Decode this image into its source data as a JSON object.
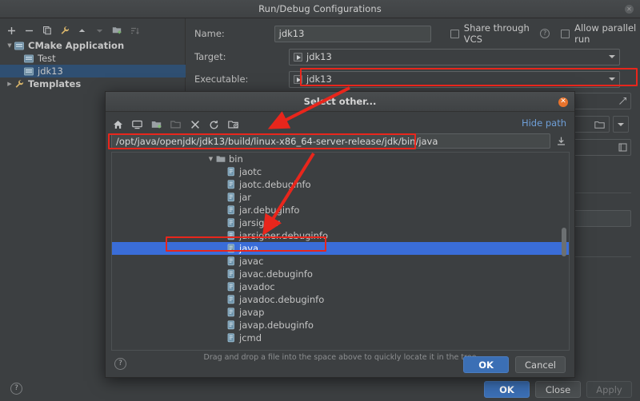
{
  "window": {
    "title": "Run/Debug Configurations",
    "close_icon": "close-icon"
  },
  "config_toolbar": {
    "items": [
      {
        "name": "add-button",
        "glyph": "+",
        "enabled": true
      },
      {
        "name": "remove-button",
        "glyph": "−",
        "enabled": true
      },
      {
        "name": "copy-button",
        "glyph": "copy-icon",
        "enabled": true
      },
      {
        "name": "edit-templates-button",
        "glyph": "wrench-icon",
        "enabled": true
      },
      {
        "name": "move-up-button",
        "glyph": "▲",
        "enabled": true
      },
      {
        "name": "move-down-button",
        "glyph": "▼",
        "enabled": false
      },
      {
        "name": "new-folder-button",
        "glyph": "folder-add-icon",
        "enabled": true
      },
      {
        "name": "sort-button",
        "glyph": "sort-icon",
        "enabled": false
      }
    ]
  },
  "config_tree": {
    "items": [
      {
        "label": "CMake Application",
        "twisty": "▼",
        "icon": "run-config-icon",
        "bold": true,
        "indent": 0,
        "selected": false
      },
      {
        "label": "Test",
        "twisty": "",
        "icon": "run-config-icon",
        "bold": false,
        "indent": 1,
        "selected": false
      },
      {
        "label": "jdk13",
        "twisty": "",
        "icon": "run-config-icon",
        "bold": false,
        "indent": 1,
        "selected": true
      },
      {
        "label": "Templates",
        "twisty": "▶",
        "icon": "wrench-icon",
        "bold": true,
        "indent": 0,
        "selected": false
      }
    ]
  },
  "form": {
    "name_label": "Name:",
    "name_value": "jdk13",
    "share_vcs_label": "Share through VCS",
    "share_vcs_checked": false,
    "share_vcs_help": "?",
    "allow_parallel_label": "Allow parallel run",
    "allow_parallel_checked": false,
    "target_label": "Target:",
    "target_value": "jdk13",
    "executable_label": "Executable:",
    "executable_value": "jdk13"
  },
  "footer": {
    "help": "?",
    "ok": "OK",
    "close": "Close",
    "apply": "Apply",
    "apply_enabled": false
  },
  "dialog": {
    "title": "Select other...",
    "close_icon": "close-icon",
    "toolbar": [
      {
        "name": "home-icon",
        "enabled": true
      },
      {
        "name": "desktop-icon",
        "enabled": true
      },
      {
        "name": "new-folder-icon",
        "enabled": true
      },
      {
        "name": "folder-icon",
        "enabled": false
      },
      {
        "name": "delete-icon",
        "enabled": true
      },
      {
        "name": "refresh-icon",
        "enabled": true
      },
      {
        "name": "show-hidden-icon",
        "enabled": true
      }
    ],
    "hide_path_label": "Hide path",
    "path_value": "/opt/java/openjdk/jdk13/build/linux-x86_64-server-release/jdk/bin/java",
    "download_icon": "download-icon",
    "tree": [
      {
        "label": "bin",
        "type": "folder",
        "twisty": "▼",
        "selected": false
      },
      {
        "label": "jaotc",
        "type": "file",
        "twisty": "",
        "selected": false
      },
      {
        "label": "jaotc.debuginfo",
        "type": "file",
        "twisty": "",
        "selected": false
      },
      {
        "label": "jar",
        "type": "file",
        "twisty": "",
        "selected": false
      },
      {
        "label": "jar.debuginfo",
        "type": "file",
        "twisty": "",
        "selected": false
      },
      {
        "label": "jarsigner",
        "type": "file",
        "twisty": "",
        "selected": false
      },
      {
        "label": "jarsigner.debuginfo",
        "type": "file",
        "twisty": "",
        "selected": false
      },
      {
        "label": "java",
        "type": "file",
        "twisty": "",
        "selected": true
      },
      {
        "label": "javac",
        "type": "file",
        "twisty": "",
        "selected": false
      },
      {
        "label": "javac.debuginfo",
        "type": "file",
        "twisty": "",
        "selected": false
      },
      {
        "label": "javadoc",
        "type": "file",
        "twisty": "",
        "selected": false
      },
      {
        "label": "javadoc.debuginfo",
        "type": "file",
        "twisty": "",
        "selected": false
      },
      {
        "label": "javap",
        "type": "file",
        "twisty": "",
        "selected": false
      },
      {
        "label": "javap.debuginfo",
        "type": "file",
        "twisty": "",
        "selected": false
      },
      {
        "label": "jcmd",
        "type": "file",
        "twisty": "",
        "selected": false
      }
    ],
    "drag_hint": "Drag and drop a file into the space above to quickly locate it in the tree",
    "help": "?",
    "ok": "OK",
    "cancel": "Cancel"
  },
  "colors": {
    "background": "#3c3f41",
    "selection_blue": "#3a6dd8",
    "config_selection": "#2f4f72",
    "accent_link": "#6f9fd8",
    "annotation_red": "#e8261c",
    "primary_button": "#3b6fb5",
    "close_orange": "#e8732c"
  }
}
